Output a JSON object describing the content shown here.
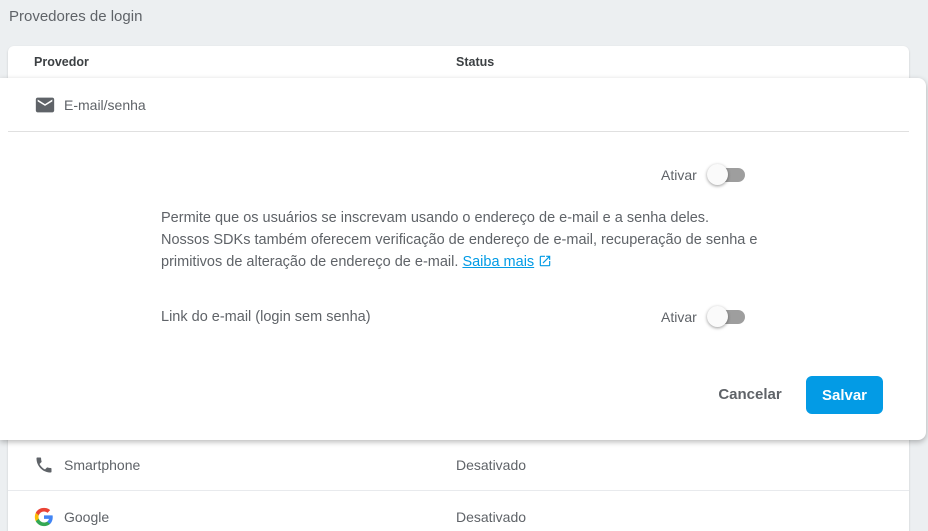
{
  "section_title": "Provedores de login",
  "table": {
    "headers": {
      "provider": "Provedor",
      "status": "Status"
    },
    "rows": [
      {
        "icon": "phone-icon",
        "name": "Smartphone",
        "status": "Desativado"
      },
      {
        "icon": "google-icon",
        "name": "Google",
        "status": "Desativado"
      }
    ]
  },
  "panel": {
    "icon": "mail-icon",
    "title": "E-mail/senha",
    "enable_label": "Ativar",
    "description": "Permite que os usuários se inscrevam usando o endereço de e-mail e a senha deles. Nossos SDKs também oferecem verificação de endereço de e-mail, recuperação de senha e primitivos de alteração de endereço de e-mail.",
    "learn_more": "Saiba mais",
    "email_link_label": "Link do e-mail (login sem senha)",
    "email_link_enable_label": "Ativar",
    "cancel_label": "Cancelar",
    "save_label": "Salvar"
  },
  "colors": {
    "accent": "#039be5",
    "background": "#eceff1"
  }
}
